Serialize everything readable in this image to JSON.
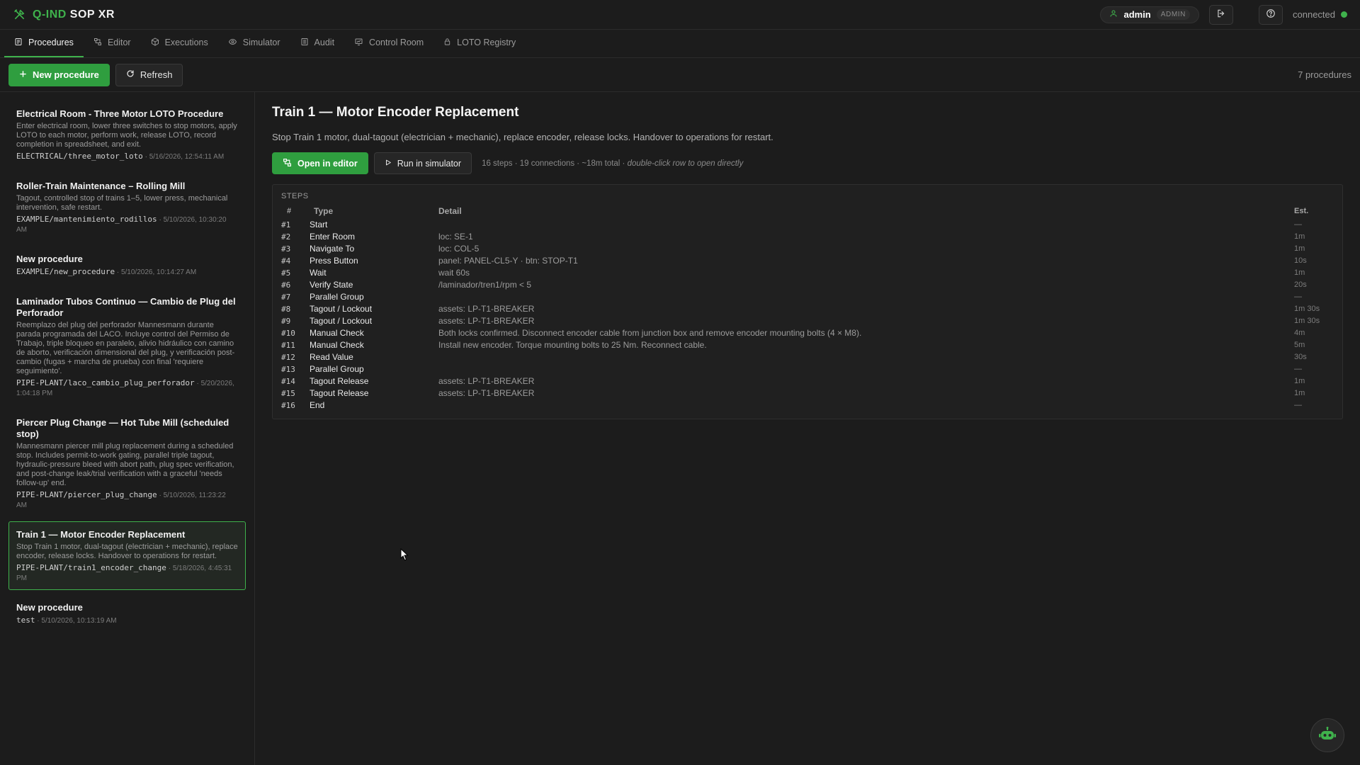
{
  "app": {
    "brand_accent": "Q-IND",
    "brand_rest": "SOP XR",
    "accent_color": "#3fb24c"
  },
  "user": {
    "name": "admin",
    "role": "ADMIN"
  },
  "connection": {
    "status": "connected",
    "color": "#3fb24c"
  },
  "tabs": [
    {
      "label": "Procedures",
      "icon": "list-icon",
      "active": true
    },
    {
      "label": "Editor",
      "icon": "flow-icon"
    },
    {
      "label": "Executions",
      "icon": "cube-icon"
    },
    {
      "label": "Simulator",
      "icon": "eye-icon"
    },
    {
      "label": "Audit",
      "icon": "document-icon"
    },
    {
      "label": "Control Room",
      "icon": "monitor-icon"
    },
    {
      "label": "LOTO Registry",
      "icon": "lock-icon"
    }
  ],
  "toolbar": {
    "new_label": "New procedure",
    "refresh_label": "Refresh",
    "count": "7 procedures"
  },
  "procedures": [
    {
      "title": "Electrical Room - Three Motor LOTO Procedure",
      "desc": "Enter electrical room, lower three switches to stop motors, apply LOTO to each motor, perform work, release LOTO, record completion in spreadsheet, and exit.",
      "key": "ELECTRICAL/three_motor_loto",
      "date": "5/16/2026, 12:54:11 AM"
    },
    {
      "title": "Roller-Train Maintenance – Rolling Mill",
      "desc": "Tagout, controlled stop of trains 1–5, lower press, mechanical intervention, safe restart.",
      "key": "EXAMPLE/mantenimiento_rodillos",
      "date": "5/10/2026, 10:30:20 AM"
    },
    {
      "title": "New procedure",
      "desc": "",
      "key": "EXAMPLE/new_procedure",
      "date": "5/10/2026, 10:14:27 AM"
    },
    {
      "title": "Laminador Tubos Continuo — Cambio de Plug del Perforador",
      "desc": "Reemplazo del plug del perforador Mannesmann durante parada programada del LACO. Incluye control del Permiso de Trabajo, triple bloqueo en paralelo, alivio hidráulico con camino de aborto, verificación dimensional del plug, y verificación post-cambio (fugas + marcha de prueba) con final 'requiere seguimiento'.",
      "key": "PIPE-PLANT/laco_cambio_plug_perforador",
      "date": "5/20/2026, 1:04:18 PM"
    },
    {
      "title": "Piercer Plug Change — Hot Tube Mill (scheduled stop)",
      "desc": "Mannesmann piercer mill plug replacement during a scheduled stop. Includes permit-to-work gating, parallel triple tagout, hydraulic-pressure bleed with abort path, plug spec verification, and post-change leak/trial verification with a graceful 'needs follow-up' end.",
      "key": "PIPE-PLANT/piercer_plug_change",
      "date": "5/10/2026, 11:23:22 AM"
    },
    {
      "title": "Train 1 — Motor Encoder Replacement",
      "desc": "Stop Train 1 motor, dual-tagout (electrician + mechanic), replace encoder, release locks. Handover to operations for restart.",
      "key": "PIPE-PLANT/train1_encoder_change",
      "date": "5/18/2026, 4:45:31 PM",
      "selected": true
    },
    {
      "title": "New procedure",
      "desc": "",
      "key": "test",
      "date": "5/10/2026, 10:13:19 AM"
    }
  ],
  "detail": {
    "title": "Train 1 — Motor Encoder Replacement",
    "desc": "Stop Train 1 motor, dual-tagout (electrician + mechanic), replace encoder, release locks. Handover to operations for restart.",
    "open_editor_label": "Open in editor",
    "run_sim_label": "Run in simulator",
    "stats": "16 steps · 19 connections · ~18m total ·",
    "hint": "double-click row to open directly",
    "steps_heading": "STEPS",
    "columns": {
      "num": "#",
      "type": "Type",
      "detail": "Detail",
      "est": "Est."
    },
    "steps": [
      {
        "num": "#1",
        "type": "Start",
        "detail": "",
        "est": "—"
      },
      {
        "num": "#2",
        "type": "Enter Room",
        "detail": "loc: SE-1",
        "est": "1m"
      },
      {
        "num": "#3",
        "type": "Navigate To",
        "detail": "loc: COL-5",
        "est": "1m"
      },
      {
        "num": "#4",
        "type": "Press Button",
        "detail": "panel: PANEL-CL5-Y · btn: STOP-T1",
        "est": "10s"
      },
      {
        "num": "#5",
        "type": "Wait",
        "detail": "wait 60s",
        "est": "1m"
      },
      {
        "num": "#6",
        "type": "Verify State",
        "detail": "/laminador/tren1/rpm < 5",
        "est": "20s"
      },
      {
        "num": "#7",
        "type": "Parallel Group",
        "detail": "",
        "est": "—"
      },
      {
        "num": "#8",
        "type": "Tagout / Lockout",
        "detail": "assets: LP-T1-BREAKER",
        "est": "1m 30s"
      },
      {
        "num": "#9",
        "type": "Tagout / Lockout",
        "detail": "assets: LP-T1-BREAKER",
        "est": "1m 30s"
      },
      {
        "num": "#10",
        "type": "Manual Check",
        "detail": "Both locks confirmed. Disconnect encoder cable from junction box and remove encoder mounting bolts (4 × M8).",
        "est": "4m"
      },
      {
        "num": "#11",
        "type": "Manual Check",
        "detail": "Install new encoder. Torque mounting bolts to 25 Nm. Reconnect cable.",
        "est": "5m"
      },
      {
        "num": "#12",
        "type": "Read Value",
        "detail": "",
        "est": "30s"
      },
      {
        "num": "#13",
        "type": "Parallel Group",
        "detail": "",
        "est": "—"
      },
      {
        "num": "#14",
        "type": "Tagout Release",
        "detail": "assets: LP-T1-BREAKER",
        "est": "1m"
      },
      {
        "num": "#15",
        "type": "Tagout Release",
        "detail": "assets: LP-T1-BREAKER",
        "est": "1m"
      },
      {
        "num": "#16",
        "type": "End",
        "detail": "",
        "est": "—"
      }
    ]
  }
}
